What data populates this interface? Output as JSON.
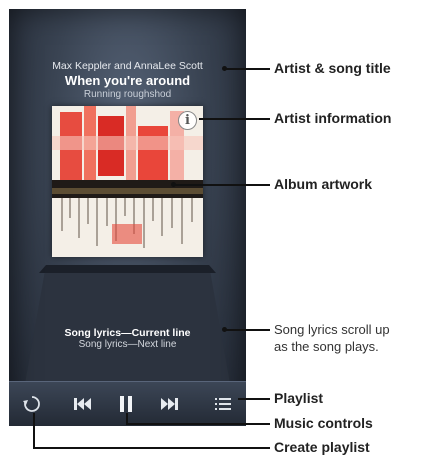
{
  "now_playing": {
    "artist": "Max Keppler and AnnaLee Scott",
    "song_title": "When you're around",
    "album": "Running roughshod"
  },
  "lyrics": {
    "current_line": "Song lyrics—Current line",
    "next_line": "Song lyrics—Next line"
  },
  "controls": {
    "create_playlist": "create-playlist-icon",
    "previous": "previous-track-icon",
    "pause": "pause-icon",
    "next": "next-track-icon",
    "playlist": "playlist-icon"
  },
  "callouts": {
    "artist_song_title": "Artist & song title",
    "artist_information": "Artist information",
    "album_artwork": "Album artwork",
    "lyrics_note_line1": "Song lyrics scroll up",
    "lyrics_note_line2": "as the song plays.",
    "playlist": "Playlist",
    "music_controls": "Music controls",
    "create_playlist": "Create playlist"
  },
  "colors": {
    "screen_bg": "#3a4453",
    "callout_line": "#111111",
    "art_red": "#e0312c"
  }
}
